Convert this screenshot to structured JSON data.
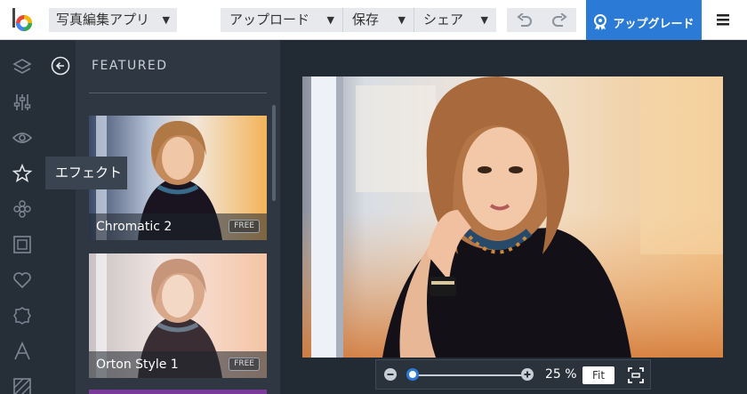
{
  "header": {
    "app_menu": "写真編集アプリ",
    "menus": [
      {
        "label": "アップロード"
      },
      {
        "label": "保存"
      },
      {
        "label": "シェア"
      }
    ],
    "upgrade_label": "アップグレード"
  },
  "sidebar": {
    "tools": [
      "layers-icon",
      "sliders-icon",
      "eye-icon",
      "star-icon",
      "flower-icon",
      "frame-icon",
      "heart-icon",
      "badge-icon",
      "text-icon",
      "texture-icon"
    ],
    "tooltip": "エフェクト"
  },
  "panel": {
    "title": "FEATURED",
    "effects": [
      {
        "name": "Chromatic 2",
        "badge": "FREE"
      },
      {
        "name": "Orton Style 1",
        "badge": "FREE"
      }
    ]
  },
  "zoom": {
    "percent": "25 %",
    "fit_label": "Fit"
  },
  "colors": {
    "accent": "#2b7bd6",
    "rail": "#262e38",
    "panel": "#2e3742",
    "canvas": "#222a34"
  }
}
